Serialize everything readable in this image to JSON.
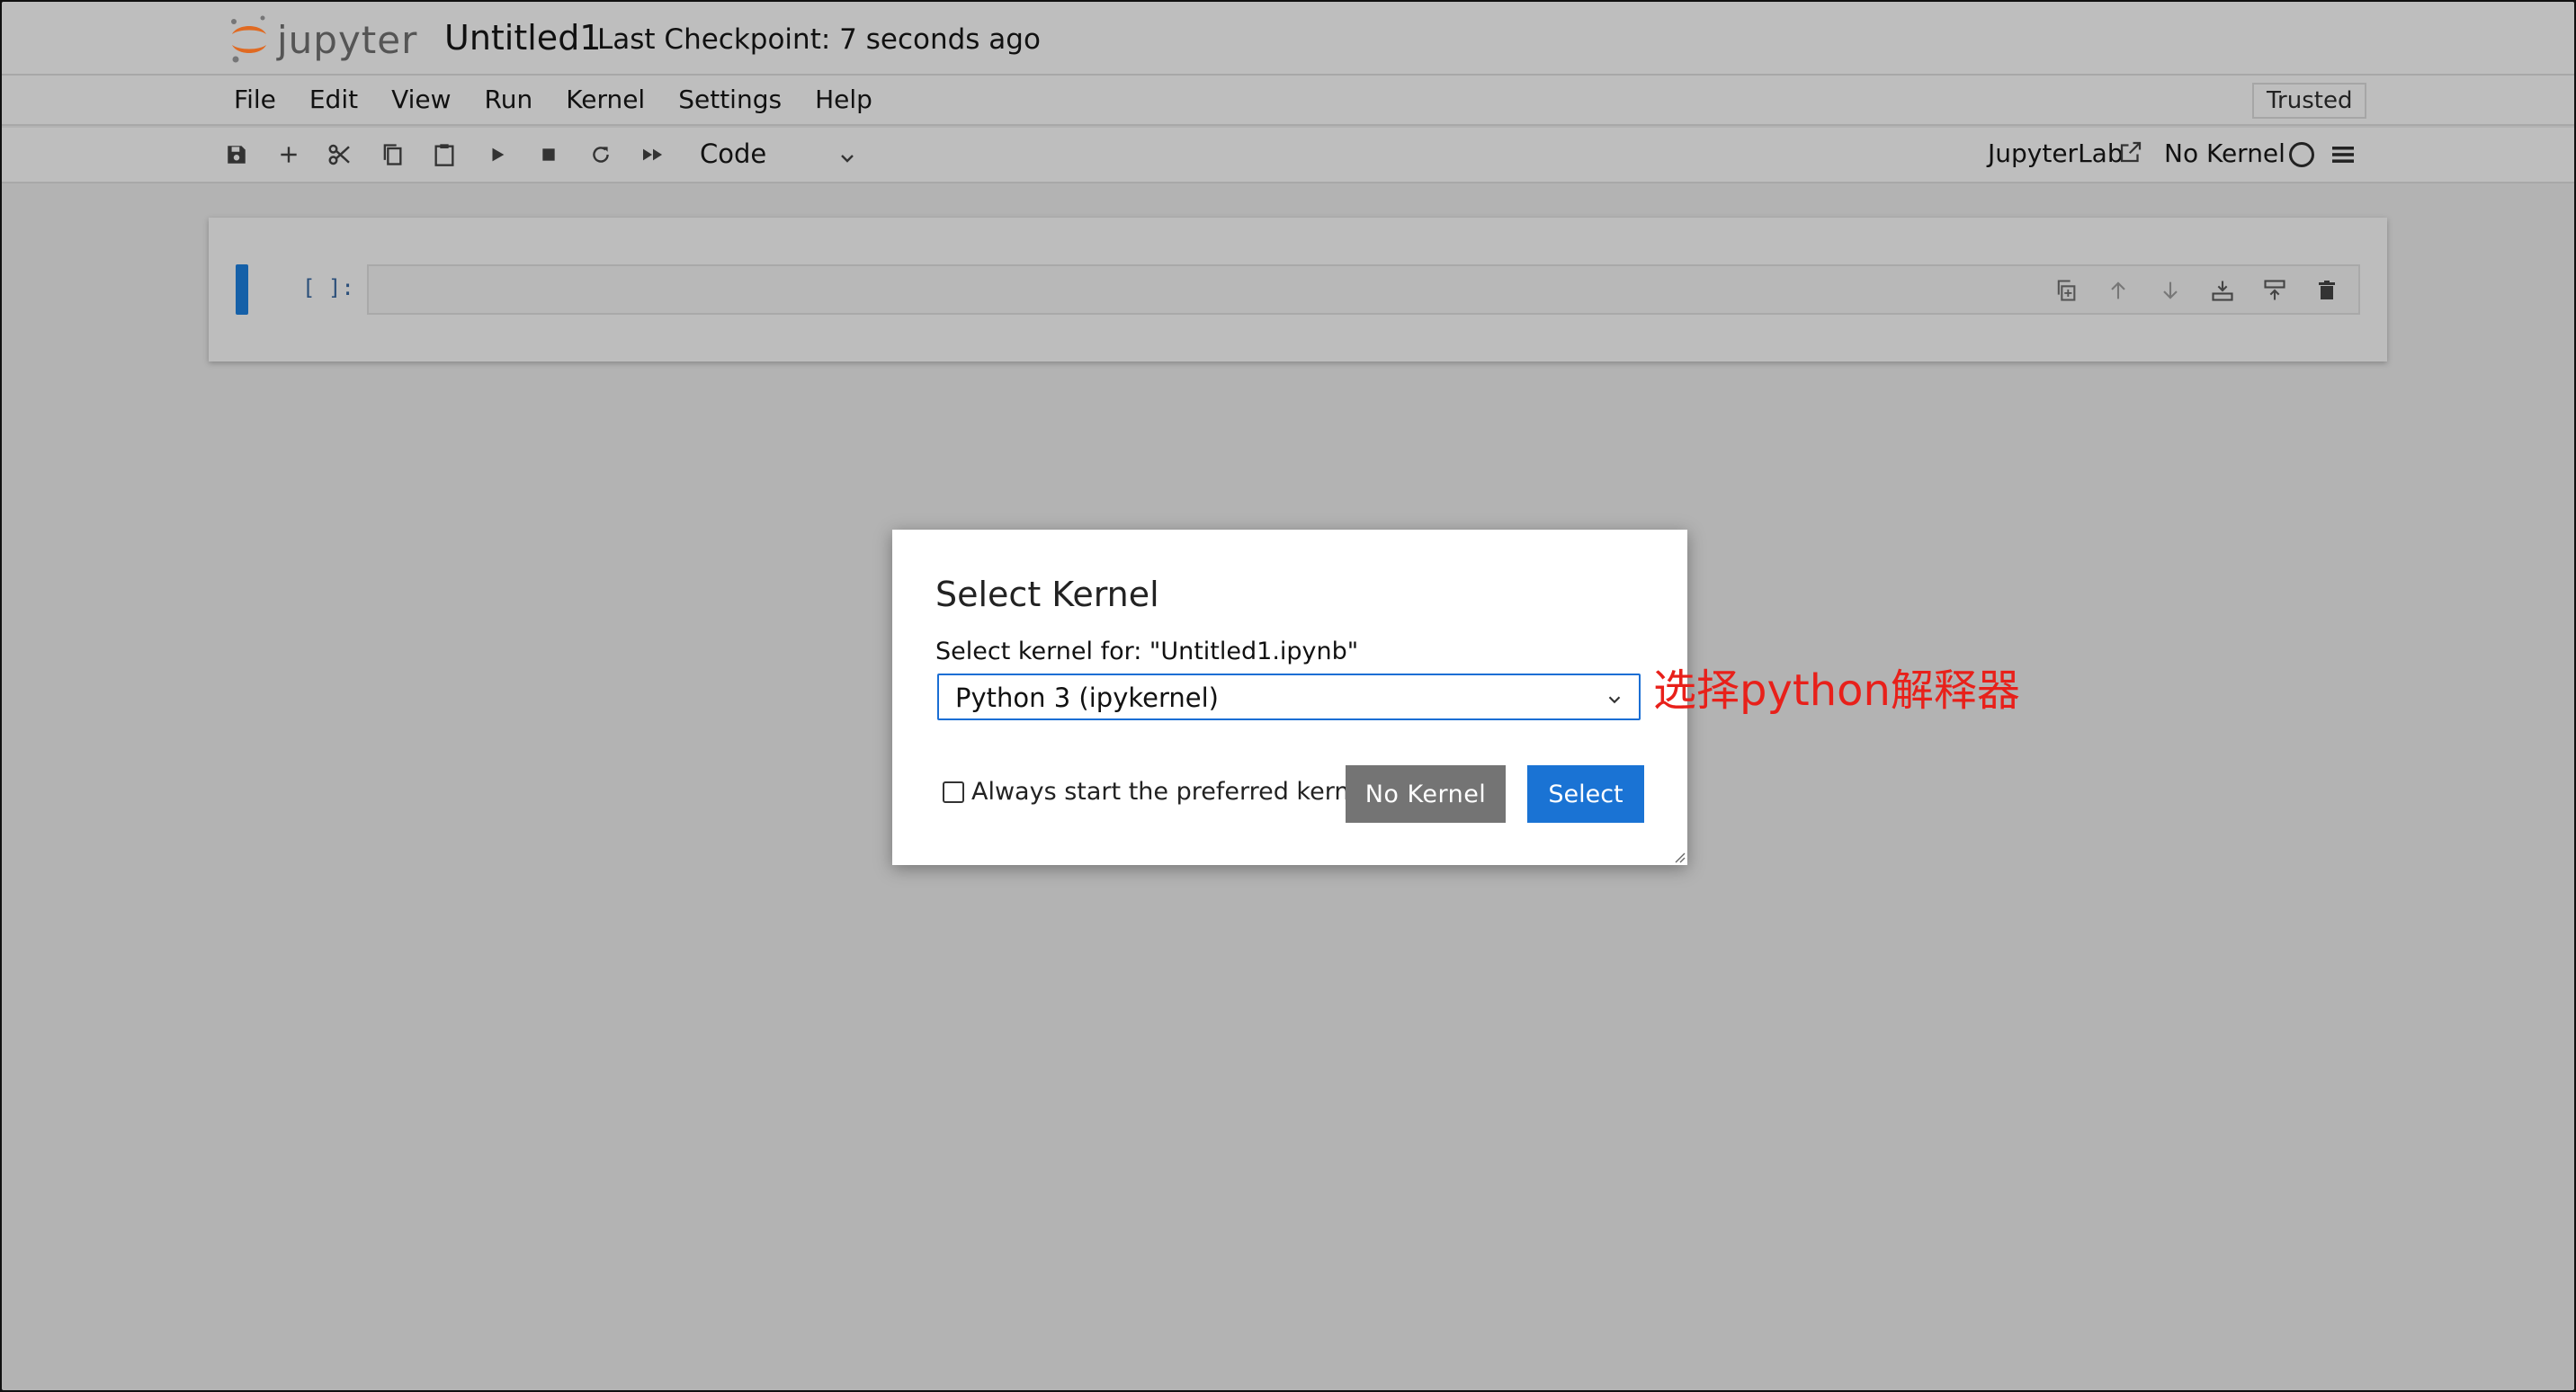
{
  "header": {
    "logo_text": "jupyter",
    "notebook_title": "Untitled1",
    "checkpoint": "Last Checkpoint: 7 seconds ago"
  },
  "menu": {
    "items": [
      "File",
      "Edit",
      "View",
      "Run",
      "Kernel",
      "Settings",
      "Help"
    ],
    "trusted": "Trusted"
  },
  "toolbar": {
    "icons": [
      "save-icon",
      "add-icon",
      "cut-icon",
      "copy-icon",
      "paste-icon",
      "run-icon",
      "stop-icon",
      "restart-icon",
      "fast-forward-icon"
    ],
    "cell_type": "Code",
    "jupyterlab_label": "JupyterLab",
    "kernel_status": "No Kernel"
  },
  "cell": {
    "prompt": "[ ]:"
  },
  "dialog": {
    "title": "Select Kernel",
    "label": "Select kernel for: \"Untitled1.ipynb\"",
    "selected_kernel": "Python 3 (ipykernel)",
    "checkbox_label": "Always start the preferred kernel",
    "no_kernel_button": "No Kernel",
    "select_button": "Select"
  },
  "annotation": {
    "text": "选择python解释器",
    "color": "#e8201a"
  },
  "colors": {
    "accent": "#1a73d4",
    "cell_active": "#1560a8",
    "overlay_bg": "#b3b3b3"
  }
}
